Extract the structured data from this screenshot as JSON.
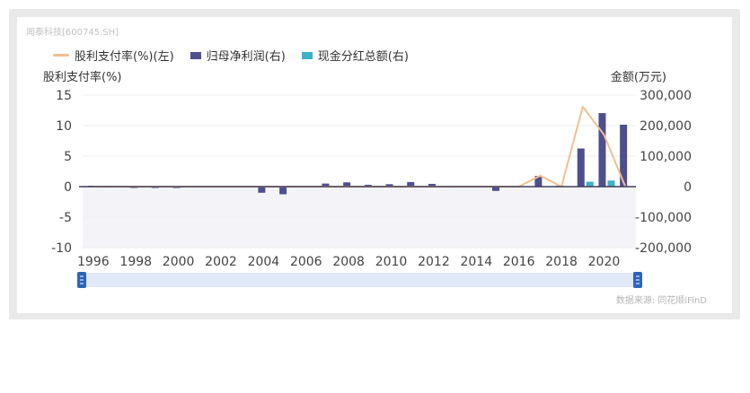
{
  "header": {
    "stock_label": "闻泰科技[600745.SH]"
  },
  "legend": [
    {
      "name": "股利支付率(%)(左)",
      "kind": "line",
      "color": "#f2c08f"
    },
    {
      "name": "归母净利润(右)",
      "kind": "box",
      "color": "#4d4f8f"
    },
    {
      "name": "现金分红总额(右)",
      "kind": "box",
      "color": "#3fb1c6"
    }
  ],
  "footer": {
    "source": "数据来源: 同花顺iFinD"
  },
  "chart_data": {
    "type": "bar",
    "left_axis_label": "股利支付率(%)",
    "right_axis_label": "金额(万元)",
    "left_ylim": [
      -10,
      15
    ],
    "left_ticks": [
      "15",
      "10",
      "5",
      "0",
      "-5",
      "-10"
    ],
    "right_ylim": [
      -200000,
      300000
    ],
    "right_ticks": [
      "300,000",
      "200,000",
      "100,000",
      "0",
      "-100,000",
      "-200,000"
    ],
    "x_tick_labels": [
      "1996",
      "1998",
      "2000",
      "2002",
      "2004",
      "2006",
      "2008",
      "2010",
      "2012",
      "2014",
      "2016",
      "2018",
      "2020"
    ],
    "categories": [
      "1996",
      "1997",
      "1998",
      "1999",
      "2000",
      "2001",
      "2002",
      "2003",
      "2004",
      "2005",
      "2006",
      "2007",
      "2008",
      "2009",
      "2010",
      "2011",
      "2012",
      "2013",
      "2014",
      "2015",
      "2016",
      "2017",
      "2018",
      "2019",
      "2020",
      "2021"
    ],
    "series": [
      {
        "name": "股利支付率(%)(左)",
        "kind": "line",
        "color": "#f2c08f",
        "values": [
          0,
          0,
          0,
          0,
          0,
          0,
          0,
          0,
          0,
          0,
          0,
          0,
          0,
          0,
          0,
          0,
          0,
          0,
          0,
          0,
          0,
          1.8,
          0,
          13.1,
          8.5,
          0
        ]
      },
      {
        "name": "归母净利润(右)",
        "kind": "bar",
        "color": "#4d4f8f",
        "values": [
          3000,
          3000,
          -4000,
          -4000,
          -4000,
          0,
          0,
          0,
          -20000,
          -25000,
          0,
          10000,
          14000,
          6000,
          8000,
          15000,
          9000,
          3000,
          0,
          -14000,
          3000,
          35000,
          3000,
          125000,
          241000,
          203000
        ]
      },
      {
        "name": "现金分红总额(右)",
        "kind": "bar",
        "color": "#3fb1c6",
        "values": [
          0,
          0,
          0,
          0,
          0,
          0,
          0,
          0,
          0,
          0,
          0,
          0,
          0,
          0,
          0,
          0,
          0,
          0,
          0,
          0,
          0,
          0,
          0,
          16000,
          20000,
          0
        ]
      }
    ],
    "grid": true,
    "legend_position": "top-left",
    "has_zoom_slider": true
  }
}
